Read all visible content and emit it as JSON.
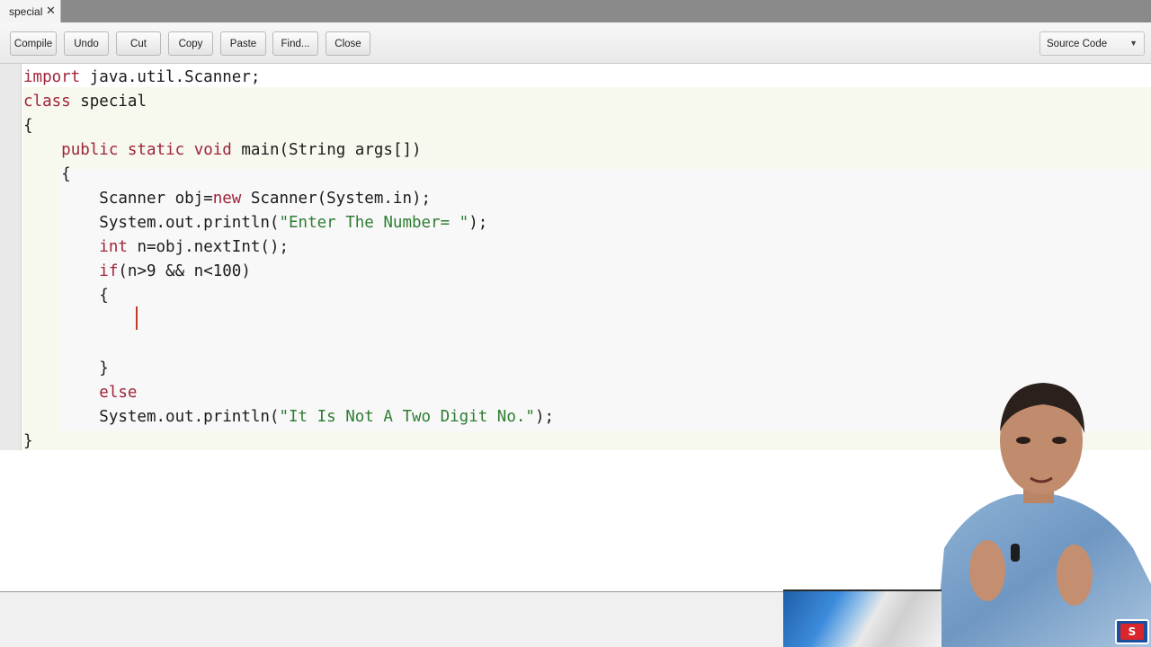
{
  "tab": {
    "label": "special",
    "close": "✕"
  },
  "toolbar": {
    "buttons": [
      "Compile",
      "Undo",
      "Cut",
      "Copy",
      "Paste",
      "Find...",
      "Close"
    ],
    "view_select": "Source Code",
    "view_arrow": "▼"
  },
  "editor": {
    "lines": [
      [
        {
          "t": "import",
          "c": "kw"
        },
        {
          "t": " java.util.Scanner;"
        }
      ],
      [
        {
          "t": "class",
          "c": "kw"
        },
        {
          "t": " special"
        }
      ],
      [
        {
          "t": "{"
        }
      ],
      [
        {
          "t": "    "
        },
        {
          "t": "public",
          "c": "kw"
        },
        {
          "t": " "
        },
        {
          "t": "static",
          "c": "kw"
        },
        {
          "t": " "
        },
        {
          "t": "void",
          "c": "kw"
        },
        {
          "t": " main(String args[])"
        }
      ],
      [
        {
          "t": "    {"
        }
      ],
      [
        {
          "t": "        Scanner obj="
        },
        {
          "t": "new",
          "c": "kw"
        },
        {
          "t": " Scanner(System.in);"
        }
      ],
      [
        {
          "t": "        System.out.println("
        },
        {
          "t": "\"Enter The Number= \"",
          "c": "str"
        },
        {
          "t": ");"
        }
      ],
      [
        {
          "t": "        "
        },
        {
          "t": "int",
          "c": "kw"
        },
        {
          "t": " n=obj.nextInt();"
        }
      ],
      [
        {
          "t": "        "
        },
        {
          "t": "if",
          "c": "kw"
        },
        {
          "t": "(n>9 && n<100)"
        }
      ],
      [
        {
          "t": "        {"
        }
      ],
      [
        {
          "t": ""
        }
      ],
      [
        {
          "t": ""
        }
      ],
      [
        {
          "t": "        }"
        }
      ],
      [
        {
          "t": "        "
        },
        {
          "t": "else",
          "c": "kw"
        }
      ],
      [
        {
          "t": "        System.out.println("
        },
        {
          "t": "\"It Is Not A Two Digit No.\"",
          "c": "str"
        },
        {
          "t": ");"
        }
      ],
      [
        {
          "t": "}"
        }
      ]
    ]
  },
  "colors": {
    "keyword": "#a0243a",
    "string": "#2e7d32",
    "caret": "#c0392b"
  },
  "overlay": {
    "logo_text": "S"
  }
}
